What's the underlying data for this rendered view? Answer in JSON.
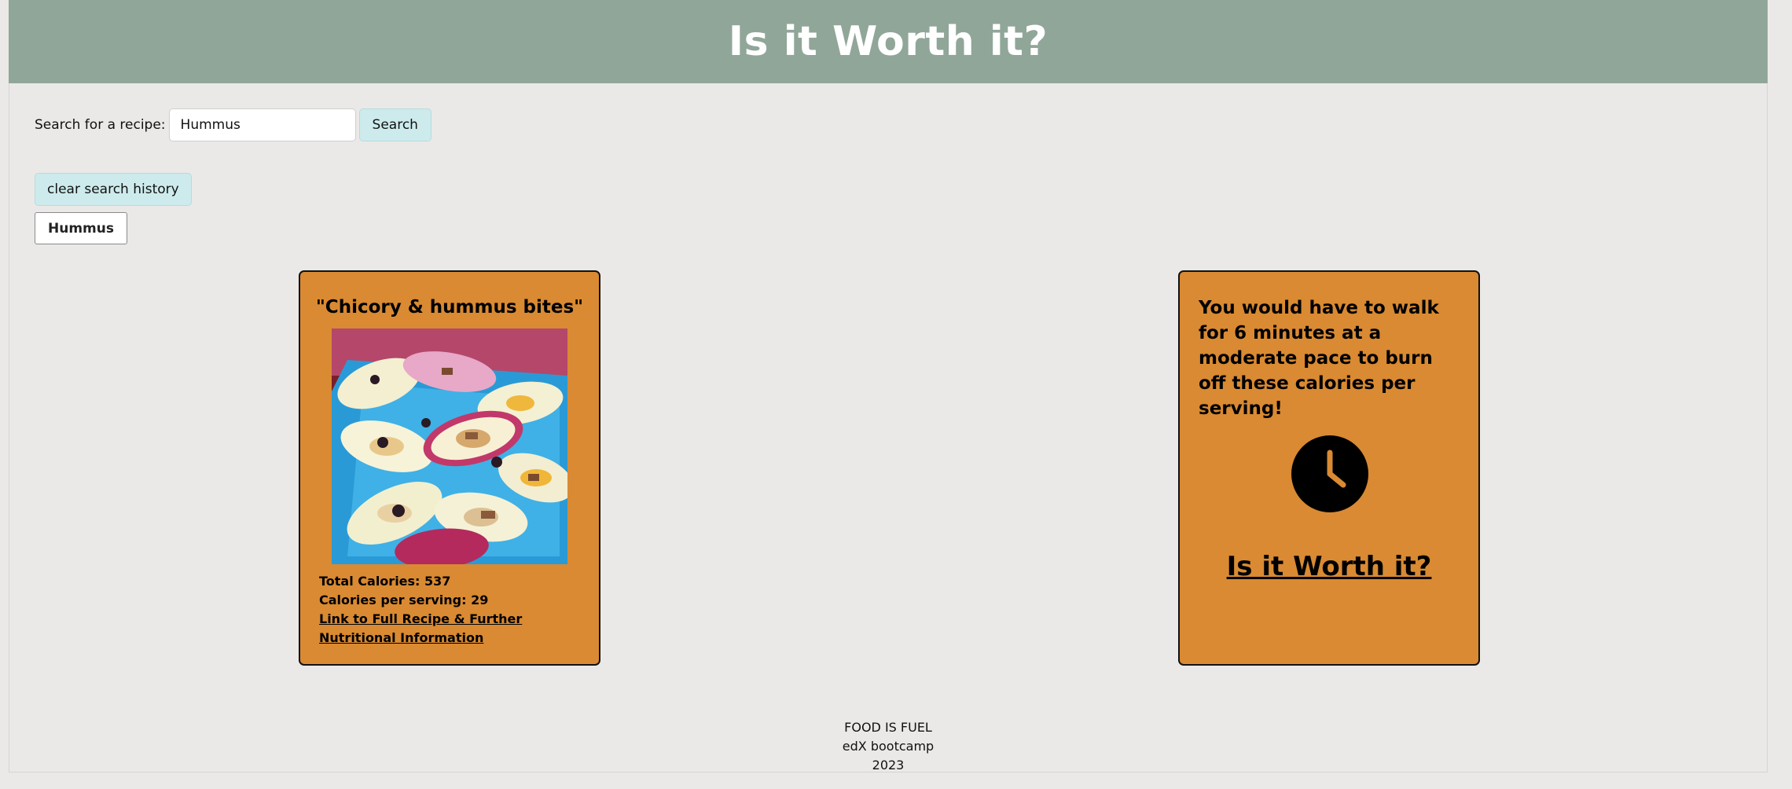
{
  "header": {
    "title": "Is it Worth it?"
  },
  "search": {
    "label": "Search for a recipe:",
    "value": "Hummus",
    "button_label": "Search"
  },
  "history": {
    "clear_label": "clear search history",
    "items": [
      "Hummus"
    ]
  },
  "recipe": {
    "title": "\"Chicory & hummus bites\"",
    "total_calories": "Total Calories: 537",
    "calories_per_serving": "Calories per serving: 29",
    "link_text": "Link to Full Recipe & Further Nutritional Information"
  },
  "burn": {
    "text": "You would have to walk for 6 minutes at a moderate pace to burn off these calories per serving!",
    "icon": "clock-icon",
    "link_text": "Is it Worth it?"
  },
  "footer": {
    "line1": "FOOD IS FUEL",
    "line2": "edX bootcamp",
    "line3": "2023"
  },
  "colors": {
    "banner": "#90a699",
    "card": "#d98a32",
    "page_bg": "#eae9e7",
    "button_accent": "#cdebec"
  }
}
